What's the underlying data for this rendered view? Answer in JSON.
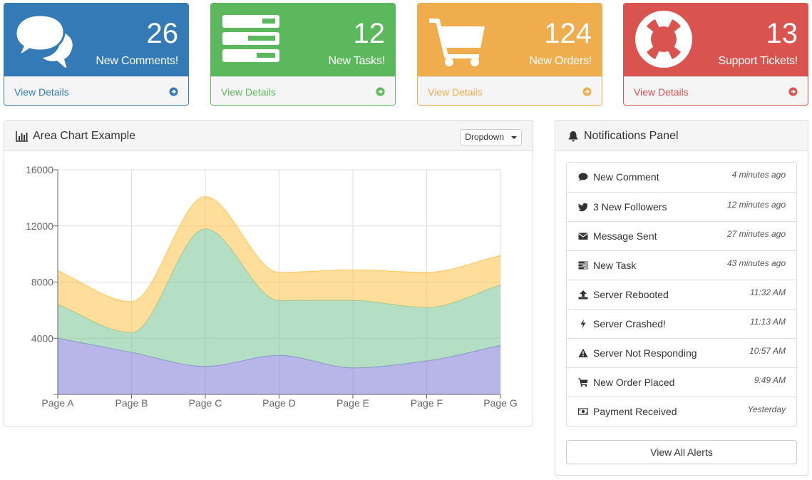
{
  "stats": [
    {
      "id": "comments",
      "number": "26",
      "label": "New Comments!",
      "link": "View Details",
      "color": "#337ab7",
      "icon": "comments-icon"
    },
    {
      "id": "tasks",
      "number": "12",
      "label": "New Tasks!",
      "link": "View Details",
      "color": "#5cb85c",
      "icon": "tasks-icon"
    },
    {
      "id": "orders",
      "number": "124",
      "label": "New Orders!",
      "link": "View Details",
      "color": "#f0ad4e",
      "icon": "shopping-cart-icon"
    },
    {
      "id": "tickets",
      "number": "13",
      "label": "Support Tickets!",
      "link": "View Details",
      "color": "#d9534f",
      "icon": "life-ring-icon"
    }
  ],
  "chart_panel": {
    "title": "Area Chart Example",
    "dropdown_label": "Dropdown"
  },
  "chart_data": {
    "type": "area",
    "stacked": true,
    "categories": [
      "Page A",
      "Page B",
      "Page C",
      "Page D",
      "Page E",
      "Page F",
      "Page G"
    ],
    "y_ticks": [
      "0",
      "4000",
      "8000",
      "12000",
      "16000"
    ],
    "ylim": [
      0,
      16000
    ],
    "grid": true,
    "series": [
      {
        "values": [
          4000,
          3000,
          2000,
          2780,
          1890,
          2390,
          3490
        ],
        "color": "#8884d8"
      },
      {
        "values": [
          2400,
          1400,
          9800,
          3908,
          4800,
          3800,
          4300
        ],
        "color": "#82ca9d"
      },
      {
        "values": [
          2400,
          2210,
          2290,
          2000,
          2181,
          2500,
          2100
        ],
        "color": "#ffc658"
      }
    ]
  },
  "notifications": {
    "title": "Notifications Panel",
    "items": [
      {
        "text": "New Comment",
        "time": "4 minutes ago",
        "icon": "comment-icon"
      },
      {
        "text": "3 New Followers",
        "time": "12 minutes ago",
        "icon": "twitter-icon"
      },
      {
        "text": "Message Sent",
        "time": "27 minutes ago",
        "icon": "envelope-icon"
      },
      {
        "text": "New Task",
        "time": "43 minutes ago",
        "icon": "tasks-icon"
      },
      {
        "text": "Server Rebooted",
        "time": "11:32 AM",
        "icon": "upload-icon"
      },
      {
        "text": "Server Crashed!",
        "time": "11:13 AM",
        "icon": "bolt-icon"
      },
      {
        "text": "Server Not Responding",
        "time": "10:57 AM",
        "icon": "warning-icon"
      },
      {
        "text": "New Order Placed",
        "time": "9:49 AM",
        "icon": "shopping-cart-icon"
      },
      {
        "text": "Payment Received",
        "time": "Yesterday",
        "icon": "money-icon"
      }
    ],
    "view_all_label": "View All Alerts"
  }
}
